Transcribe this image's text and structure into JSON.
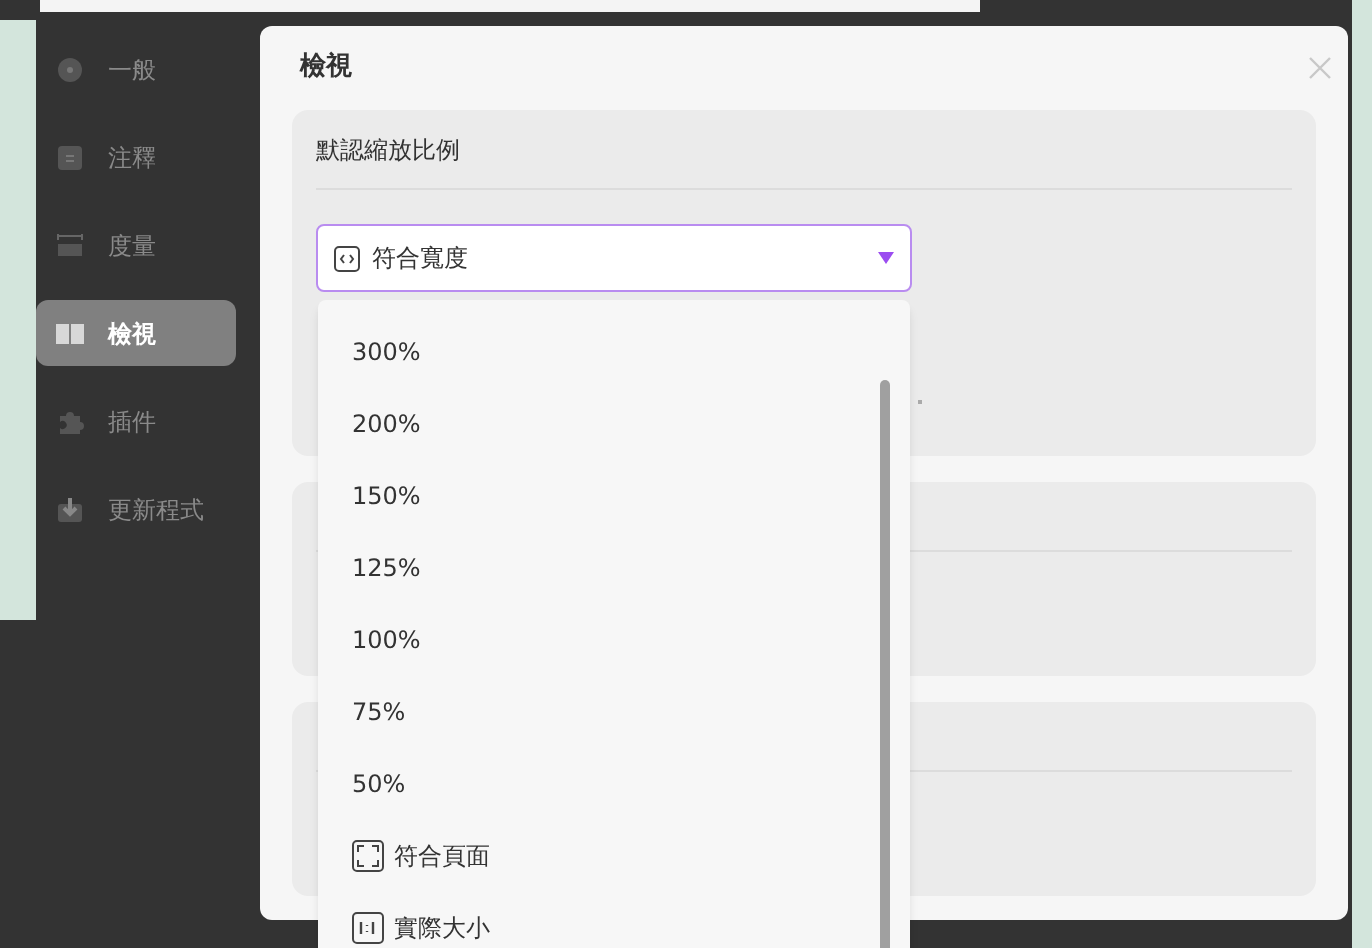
{
  "sidebar": {
    "items": [
      {
        "label": "一般",
        "selected": false
      },
      {
        "label": "注釋",
        "selected": false
      },
      {
        "label": "度量",
        "selected": false
      },
      {
        "label": "檢視",
        "selected": true
      },
      {
        "label": "插件",
        "selected": false
      },
      {
        "label": "更新程式",
        "selected": false
      }
    ]
  },
  "dialog": {
    "title": "檢視",
    "sections": [
      {
        "kind": "dropdown",
        "title": "默認縮放比例",
        "dropdown": {
          "value": "符合寬度",
          "expanded": true,
          "options": [
            {
              "kind": "plain",
              "label": "300%"
            },
            {
              "kind": "plain",
              "label": "200%"
            },
            {
              "kind": "plain",
              "label": "150%"
            },
            {
              "kind": "plain",
              "label": "125%"
            },
            {
              "kind": "plain",
              "label": "100%"
            },
            {
              "kind": "plain",
              "label": "75%"
            },
            {
              "kind": "plain",
              "label": "50%"
            },
            {
              "kind": "fitpage",
              "label": "符合頁面"
            },
            {
              "kind": "actualsize",
              "label": "實際大小"
            }
          ]
        }
      },
      {
        "kind": "blank"
      },
      {
        "kind": "blank"
      }
    ]
  }
}
